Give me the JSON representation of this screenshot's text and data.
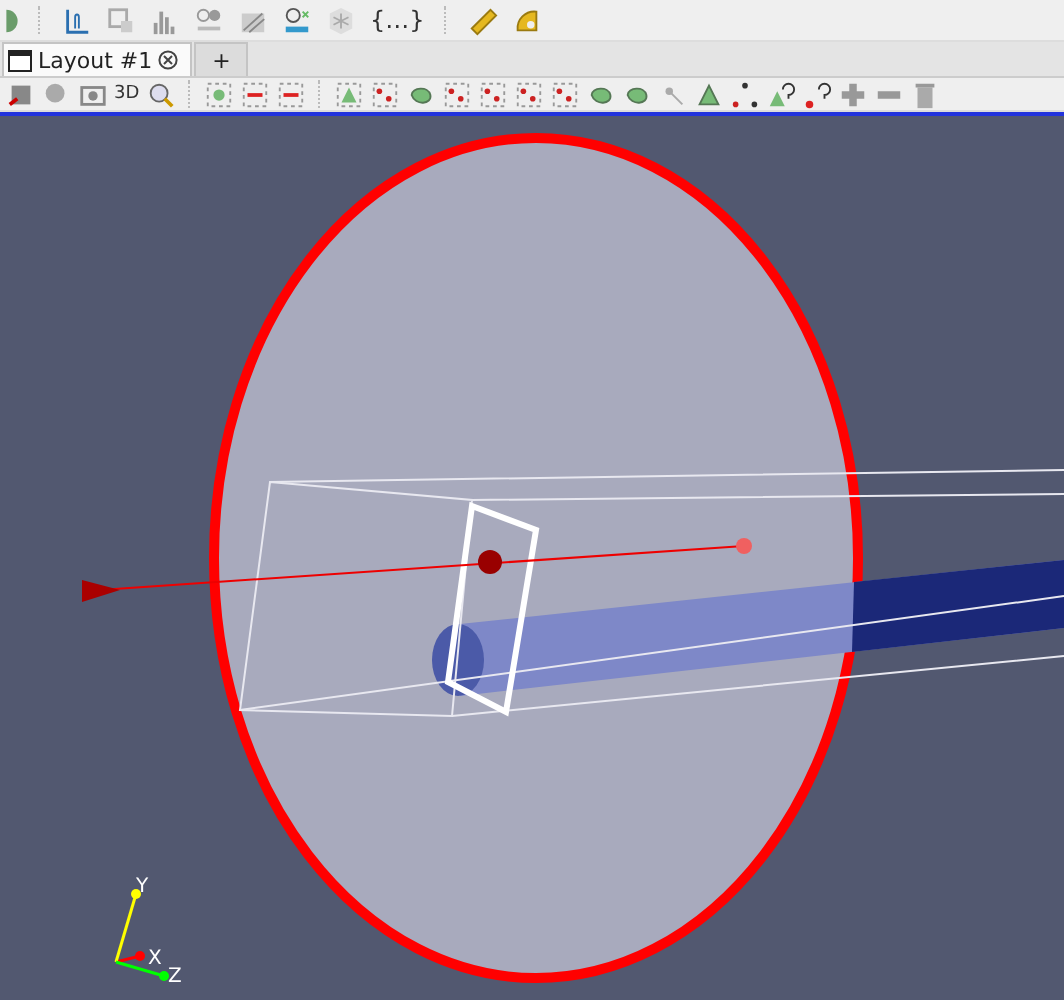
{
  "main_toolbar": {
    "brace_button": "{…}"
  },
  "tabs": [
    {
      "label": "Layout #1",
      "selected": true,
      "kind": "layout"
    },
    {
      "label": "+",
      "selected": false,
      "kind": "new"
    }
  ],
  "view_toolbar": {
    "mode_button": "3D"
  },
  "axes": [
    {
      "label": "X",
      "color": "#ff0000"
    },
    {
      "label": "Y",
      "color": "#ffff00"
    },
    {
      "label": "Z",
      "color": "#00ff00"
    }
  ]
}
